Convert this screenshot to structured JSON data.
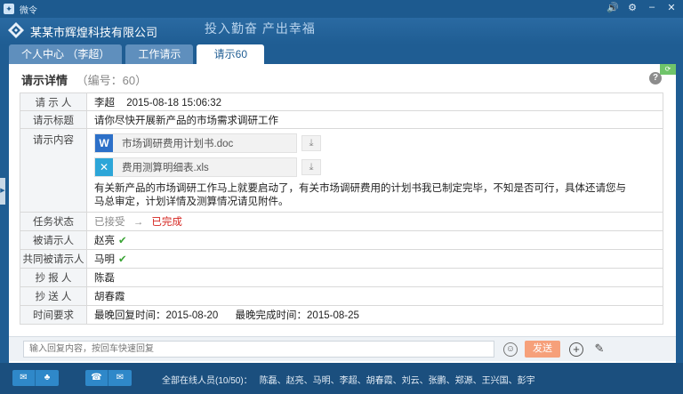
{
  "titlebar": {
    "app_name": "微令",
    "controls": [
      "🔊",
      "⚙",
      "–",
      "✕"
    ]
  },
  "header": {
    "company": "某某市辉煌科技有限公司",
    "slogan": "投入勤奋  产出幸福"
  },
  "tabs": [
    {
      "label": "个人中心  （李超）"
    },
    {
      "label": "工作请示"
    },
    {
      "label": "请示60"
    }
  ],
  "detail": {
    "title": "请示详情",
    "number": "（编号：60）",
    "help_icon": "?",
    "rows": {
      "requester": {
        "label": "请 示 人",
        "name": "李超",
        "time": "2015-08-18  15:06:32"
      },
      "subject": {
        "label": "请示标题",
        "value": "请你尽快开展新产品的市场需求调研工作"
      },
      "content": {
        "label": "请示内容",
        "attachments": [
          {
            "icon": "W",
            "name": "市场调研费用计划书.doc"
          },
          {
            "icon": "✕",
            "name": "费用测算明细表.xls"
          }
        ],
        "text": "有关新产品的市场调研工作马上就要启动了，有关市场调研费用的计划书我已制定完毕，不知是否可行，具体还请您与马总审定，计划详情及测算情况请见附件。"
      },
      "status": {
        "label": "任务状态",
        "from": "已接受",
        "arrow": "→",
        "to": "已完成"
      },
      "assignee": {
        "label": "被请示人",
        "value": "赵亮"
      },
      "co_assignee": {
        "label": "共同被请示人",
        "value": "马明"
      },
      "report_to": {
        "label": "抄 报 人",
        "value": "陈磊"
      },
      "cc": {
        "label": "抄 送 人",
        "value": "胡春霞"
      },
      "deadline": {
        "label": "时间要求",
        "reply": "最晚回复时间：2015-08-20",
        "complete": "最晚完成时间：2015-08-25"
      }
    }
  },
  "reply": {
    "placeholder": "输入回复内容，按回车快速回复",
    "send_label": "发送"
  },
  "bottom": {
    "online_label": "全部在线人员(10/50)：",
    "online_users": "陈磊、赵亮、马明、李超、胡春霞、刘云、张鹏、郑源、王兴国、彭宇"
  },
  "colors": {
    "primary": "#1f5d93",
    "status_done": "#d5241f",
    "check": "#3aa435",
    "send": "#f6a07a"
  }
}
